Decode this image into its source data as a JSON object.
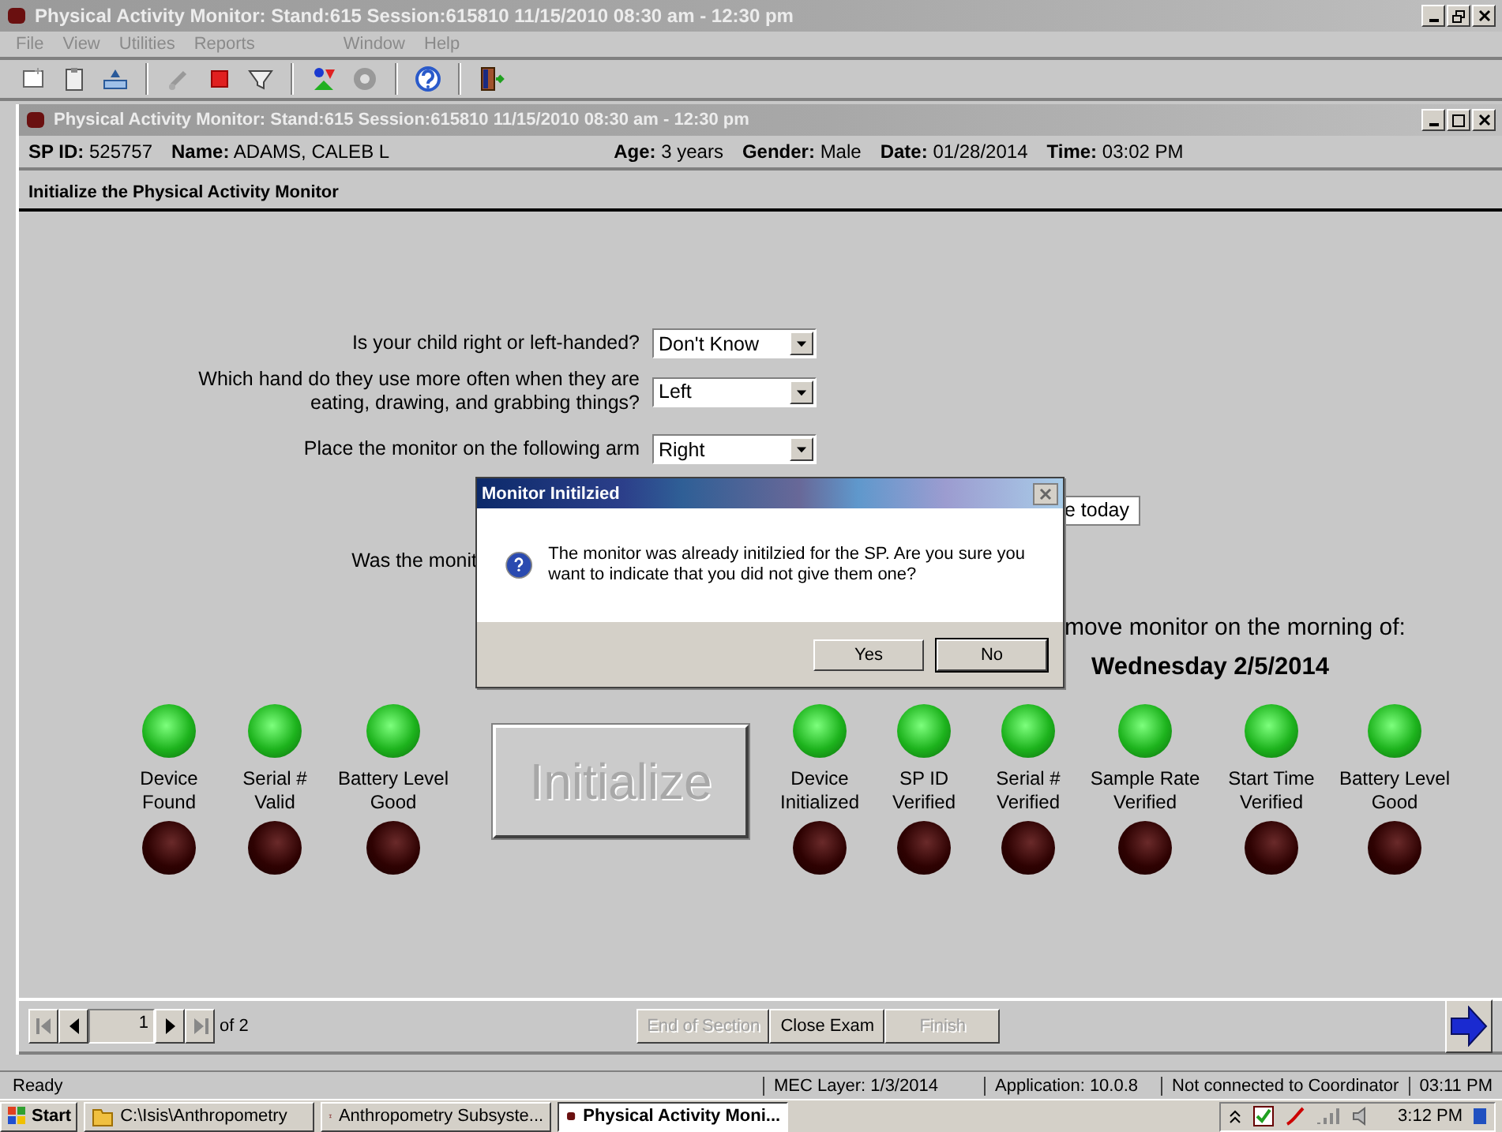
{
  "app_window": {
    "title": "Physical Activity Monitor: Stand:615 Session:615810 11/15/2010 08:30 am - 12:30 pm"
  },
  "menu": [
    {
      "label": "File"
    },
    {
      "label": "View"
    },
    {
      "label": "Utilities"
    },
    {
      "label": "Reports"
    },
    {
      "label": "Window"
    },
    {
      "label": "Help"
    }
  ],
  "child_window": {
    "title": "Physical Activity Monitor: Stand:615 Session:615810 11/15/2010 08:30 am - 12:30 pm"
  },
  "patient": [
    {
      "label": "SP ID:",
      "value": "525757"
    },
    {
      "label": "Name:",
      "value": "ADAMS, CALEB L"
    },
    {
      "label": "Age:",
      "value": "3 years"
    },
    {
      "label": "Gender:",
      "value": "Male"
    },
    {
      "label": "Date:",
      "value": "01/28/2014"
    },
    {
      "label": "Time:",
      "value": "03:02 PM"
    }
  ],
  "section_title": "Initialize the Physical Activity Monitor",
  "questions": [
    {
      "label": "Is your child right or left-handed?",
      "value": "Don't Know"
    },
    {
      "label": "Which hand do they use more often when they are eating, drawing, and grabbing things?",
      "value": "Left"
    },
    {
      "label": "Place the monitor on the following arm",
      "value": "Right"
    }
  ],
  "partial_field": {
    "value": "e today"
  },
  "partial_question": "Was the monit",
  "removal_note": "move monitor on the morning of:",
  "removal_date": "Wednesday 2/5/2014",
  "initialize_button": "Initialize",
  "indicators_left": [
    {
      "label": "Device Found",
      "ok": true
    },
    {
      "label": "Serial # Valid",
      "ok": true
    },
    {
      "label": "Battery Level Good",
      "ok": true
    }
  ],
  "indicators_right": [
    {
      "label": "Device Initialized",
      "ok": true
    },
    {
      "label": "SP ID Verified",
      "ok": true
    },
    {
      "label": "Serial # Verified",
      "ok": true
    },
    {
      "label": "Sample Rate Verified",
      "ok": true
    },
    {
      "label": "Start Time Verified",
      "ok": true
    },
    {
      "label": "Battery Level Good",
      "ok": true
    }
  ],
  "pager": {
    "page": "1",
    "of": "of 2"
  },
  "footer_buttons": [
    {
      "label": "End of Section",
      "disabled": true
    },
    {
      "label": "Close Exam",
      "disabled": false
    },
    {
      "label": "Finish",
      "disabled": true
    }
  ],
  "status_bar": [
    "Ready",
    "MEC Layer: 1/3/2014",
    "Application: 10.0.8",
    "Not connected to Coordinator",
    "03:11 PM"
  ],
  "dialog": {
    "title": "Monitor Initilzied",
    "message": "The monitor was already initilzied for the SP. Are you sure you want to indicate that you did not give them one?",
    "buttons": [
      {
        "label": "Yes",
        "focused": false
      },
      {
        "label": "No",
        "focused": true
      }
    ]
  },
  "taskbar": {
    "start": "Start",
    "items": [
      {
        "label": "C:\\Isis\\Anthropometry",
        "selected": false,
        "kind": "folder"
      },
      {
        "label": "Anthropometry Subsyste...",
        "selected": false,
        "kind": "app"
      },
      {
        "label": "Physical Activity Moni...",
        "selected": true,
        "kind": "monitor"
      }
    ],
    "clock": "3:12 PM"
  }
}
